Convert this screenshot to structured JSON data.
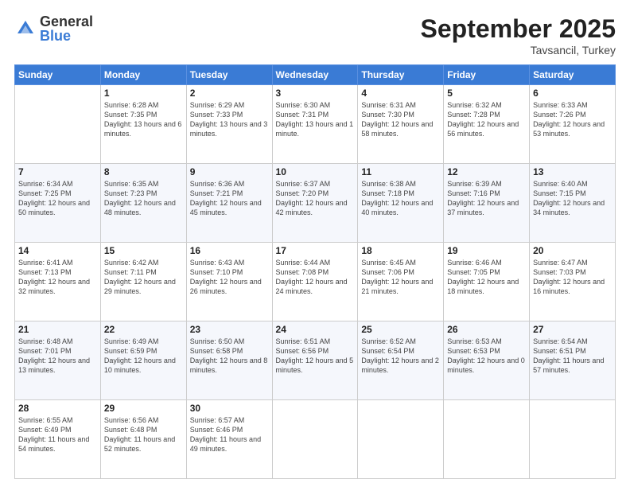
{
  "header": {
    "logo_general": "General",
    "logo_blue": "Blue",
    "month": "September 2025",
    "location": "Tavsancil, Turkey"
  },
  "days_of_week": [
    "Sunday",
    "Monday",
    "Tuesday",
    "Wednesday",
    "Thursday",
    "Friday",
    "Saturday"
  ],
  "weeks": [
    [
      {
        "day": "",
        "sunrise": "",
        "sunset": "",
        "daylight": ""
      },
      {
        "day": "1",
        "sunrise": "Sunrise: 6:28 AM",
        "sunset": "Sunset: 7:35 PM",
        "daylight": "Daylight: 13 hours and 6 minutes."
      },
      {
        "day": "2",
        "sunrise": "Sunrise: 6:29 AM",
        "sunset": "Sunset: 7:33 PM",
        "daylight": "Daylight: 13 hours and 3 minutes."
      },
      {
        "day": "3",
        "sunrise": "Sunrise: 6:30 AM",
        "sunset": "Sunset: 7:31 PM",
        "daylight": "Daylight: 13 hours and 1 minute."
      },
      {
        "day": "4",
        "sunrise": "Sunrise: 6:31 AM",
        "sunset": "Sunset: 7:30 PM",
        "daylight": "Daylight: 12 hours and 58 minutes."
      },
      {
        "day": "5",
        "sunrise": "Sunrise: 6:32 AM",
        "sunset": "Sunset: 7:28 PM",
        "daylight": "Daylight: 12 hours and 56 minutes."
      },
      {
        "day": "6",
        "sunrise": "Sunrise: 6:33 AM",
        "sunset": "Sunset: 7:26 PM",
        "daylight": "Daylight: 12 hours and 53 minutes."
      }
    ],
    [
      {
        "day": "7",
        "sunrise": "Sunrise: 6:34 AM",
        "sunset": "Sunset: 7:25 PM",
        "daylight": "Daylight: 12 hours and 50 minutes."
      },
      {
        "day": "8",
        "sunrise": "Sunrise: 6:35 AM",
        "sunset": "Sunset: 7:23 PM",
        "daylight": "Daylight: 12 hours and 48 minutes."
      },
      {
        "day": "9",
        "sunrise": "Sunrise: 6:36 AM",
        "sunset": "Sunset: 7:21 PM",
        "daylight": "Daylight: 12 hours and 45 minutes."
      },
      {
        "day": "10",
        "sunrise": "Sunrise: 6:37 AM",
        "sunset": "Sunset: 7:20 PM",
        "daylight": "Daylight: 12 hours and 42 minutes."
      },
      {
        "day": "11",
        "sunrise": "Sunrise: 6:38 AM",
        "sunset": "Sunset: 7:18 PM",
        "daylight": "Daylight: 12 hours and 40 minutes."
      },
      {
        "day": "12",
        "sunrise": "Sunrise: 6:39 AM",
        "sunset": "Sunset: 7:16 PM",
        "daylight": "Daylight: 12 hours and 37 minutes."
      },
      {
        "day": "13",
        "sunrise": "Sunrise: 6:40 AM",
        "sunset": "Sunset: 7:15 PM",
        "daylight": "Daylight: 12 hours and 34 minutes."
      }
    ],
    [
      {
        "day": "14",
        "sunrise": "Sunrise: 6:41 AM",
        "sunset": "Sunset: 7:13 PM",
        "daylight": "Daylight: 12 hours and 32 minutes."
      },
      {
        "day": "15",
        "sunrise": "Sunrise: 6:42 AM",
        "sunset": "Sunset: 7:11 PM",
        "daylight": "Daylight: 12 hours and 29 minutes."
      },
      {
        "day": "16",
        "sunrise": "Sunrise: 6:43 AM",
        "sunset": "Sunset: 7:10 PM",
        "daylight": "Daylight: 12 hours and 26 minutes."
      },
      {
        "day": "17",
        "sunrise": "Sunrise: 6:44 AM",
        "sunset": "Sunset: 7:08 PM",
        "daylight": "Daylight: 12 hours and 24 minutes."
      },
      {
        "day": "18",
        "sunrise": "Sunrise: 6:45 AM",
        "sunset": "Sunset: 7:06 PM",
        "daylight": "Daylight: 12 hours and 21 minutes."
      },
      {
        "day": "19",
        "sunrise": "Sunrise: 6:46 AM",
        "sunset": "Sunset: 7:05 PM",
        "daylight": "Daylight: 12 hours and 18 minutes."
      },
      {
        "day": "20",
        "sunrise": "Sunrise: 6:47 AM",
        "sunset": "Sunset: 7:03 PM",
        "daylight": "Daylight: 12 hours and 16 minutes."
      }
    ],
    [
      {
        "day": "21",
        "sunrise": "Sunrise: 6:48 AM",
        "sunset": "Sunset: 7:01 PM",
        "daylight": "Daylight: 12 hours and 13 minutes."
      },
      {
        "day": "22",
        "sunrise": "Sunrise: 6:49 AM",
        "sunset": "Sunset: 6:59 PM",
        "daylight": "Daylight: 12 hours and 10 minutes."
      },
      {
        "day": "23",
        "sunrise": "Sunrise: 6:50 AM",
        "sunset": "Sunset: 6:58 PM",
        "daylight": "Daylight: 12 hours and 8 minutes."
      },
      {
        "day": "24",
        "sunrise": "Sunrise: 6:51 AM",
        "sunset": "Sunset: 6:56 PM",
        "daylight": "Daylight: 12 hours and 5 minutes."
      },
      {
        "day": "25",
        "sunrise": "Sunrise: 6:52 AM",
        "sunset": "Sunset: 6:54 PM",
        "daylight": "Daylight: 12 hours and 2 minutes."
      },
      {
        "day": "26",
        "sunrise": "Sunrise: 6:53 AM",
        "sunset": "Sunset: 6:53 PM",
        "daylight": "Daylight: 12 hours and 0 minutes."
      },
      {
        "day": "27",
        "sunrise": "Sunrise: 6:54 AM",
        "sunset": "Sunset: 6:51 PM",
        "daylight": "Daylight: 11 hours and 57 minutes."
      }
    ],
    [
      {
        "day": "28",
        "sunrise": "Sunrise: 6:55 AM",
        "sunset": "Sunset: 6:49 PM",
        "daylight": "Daylight: 11 hours and 54 minutes."
      },
      {
        "day": "29",
        "sunrise": "Sunrise: 6:56 AM",
        "sunset": "Sunset: 6:48 PM",
        "daylight": "Daylight: 11 hours and 52 minutes."
      },
      {
        "day": "30",
        "sunrise": "Sunrise: 6:57 AM",
        "sunset": "Sunset: 6:46 PM",
        "daylight": "Daylight: 11 hours and 49 minutes."
      },
      {
        "day": "",
        "sunrise": "",
        "sunset": "",
        "daylight": ""
      },
      {
        "day": "",
        "sunrise": "",
        "sunset": "",
        "daylight": ""
      },
      {
        "day": "",
        "sunrise": "",
        "sunset": "",
        "daylight": ""
      },
      {
        "day": "",
        "sunrise": "",
        "sunset": "",
        "daylight": ""
      }
    ]
  ]
}
